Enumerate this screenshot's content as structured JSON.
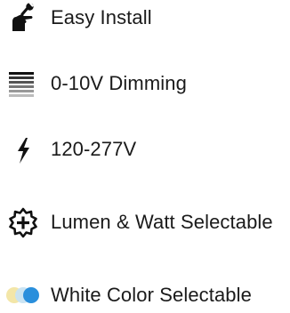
{
  "features": [
    {
      "icon": "hand-wrench-icon",
      "label": "Easy Install"
    },
    {
      "icon": "dimming-bars-icon",
      "label": "0-10V Dimming"
    },
    {
      "icon": "lightning-bolt-icon",
      "label": "120-277V"
    },
    {
      "icon": "badge-plus-icon",
      "label": "Lumen & Watt Selectable"
    },
    {
      "icon": "color-circles-icon",
      "label": "White Color Selectable"
    }
  ],
  "colors": {
    "text": "#1a1a1a",
    "icon": "#111111",
    "warm_white": "#f3e6a8",
    "neutral_white": "#c8e3f2",
    "cool_white": "#2a8fdc"
  }
}
